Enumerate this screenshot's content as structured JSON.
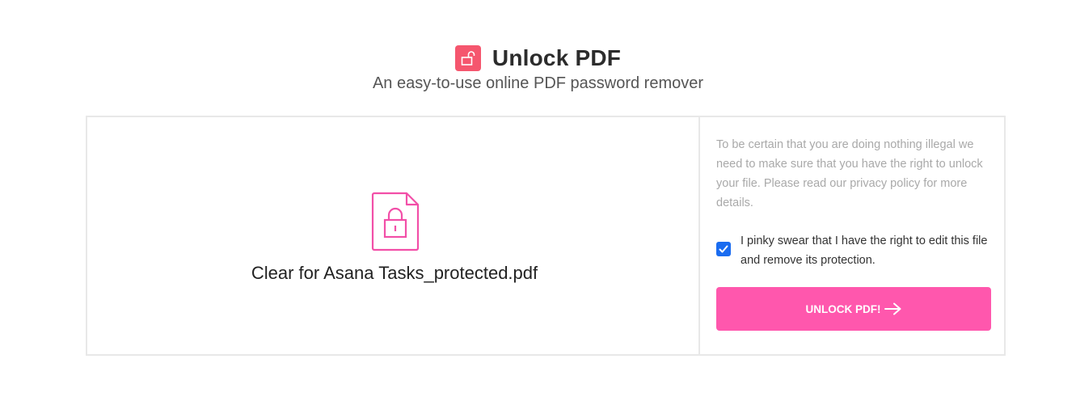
{
  "header": {
    "title": "Unlock PDF",
    "subtitle": "An easy-to-use online PDF password remover",
    "icon": "unlocked-padlock-icon"
  },
  "file": {
    "name": "Clear for Asana Tasks_protected.pdf",
    "icon": "locked-file-icon"
  },
  "side": {
    "notice": "To be certain that you are doing nothing illegal we need to make sure that you have the right to unlock your file. Please read our privacy policy for more details.",
    "consent_label": "I pinky swear that I have the right to edit this file and remove its protection.",
    "consent_checked": true,
    "unlock_button_label": "UNLOCK PDF!"
  },
  "colors": {
    "brand_red": "#f5566e",
    "button_pink": "#ff57ad",
    "file_icon_pink": "#f24fa8",
    "checkbox_blue": "#1a6cf0"
  }
}
